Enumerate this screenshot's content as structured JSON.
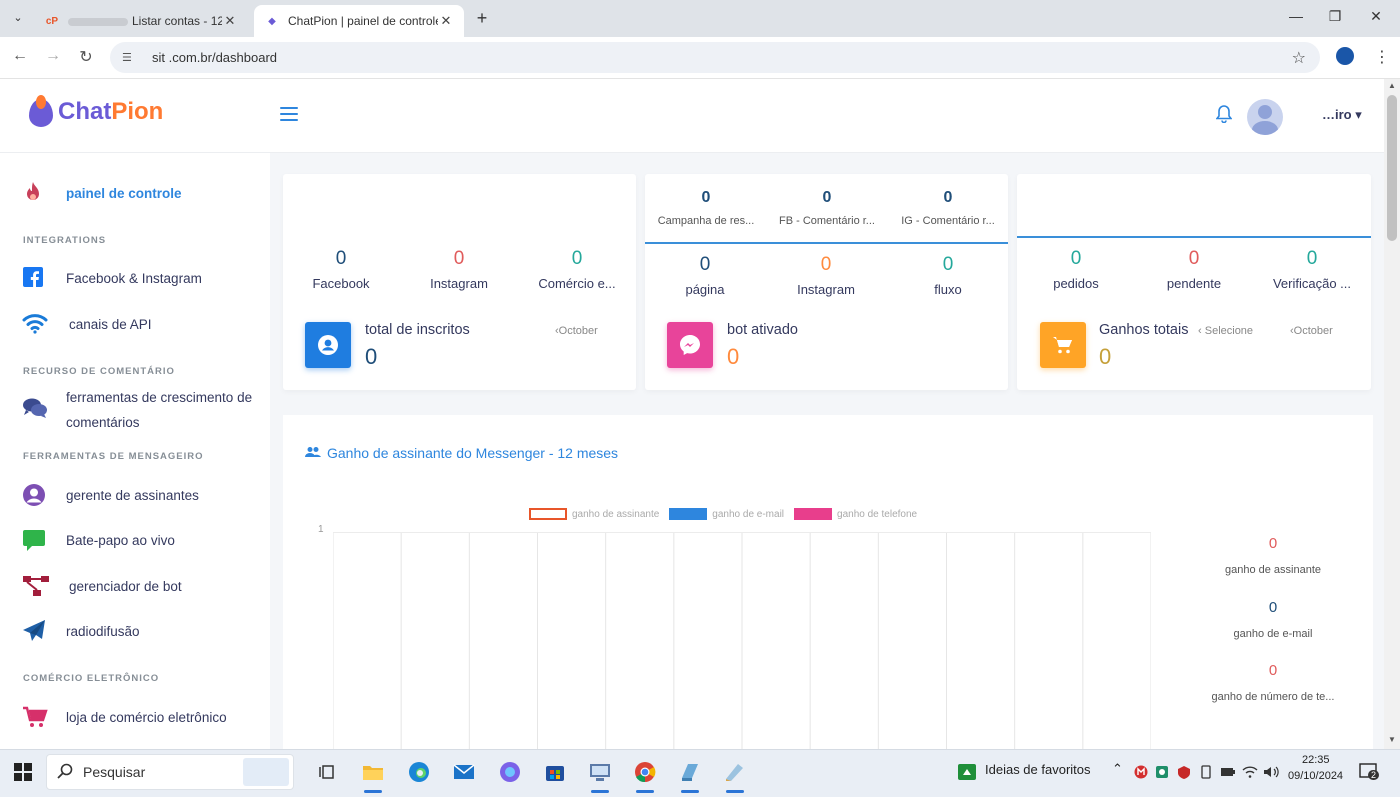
{
  "browser": {
    "tab_inactive": {
      "title": "Listar contas - 12"
    },
    "tab_active": {
      "title": "ChatPion | painel de controle"
    },
    "url": "sit .com.br/dashboard"
  },
  "header": {
    "logo_chat": "Chat",
    "logo_pion": "Pion",
    "username": "…iro"
  },
  "sidebar": {
    "dashboard": "painel de controle",
    "integrations_head": "INTEGRATIONS",
    "facebook_instagram": "Facebook & Instagram",
    "api_channels": "canais de API",
    "comment_head": "RECURSO DE COMENTÁRIO",
    "comment_tools_1": "ferramentas de crescimento de",
    "comment_tools_2": "comentários",
    "messenger_head": "FERRAMENTAS DE MENSAGEIRO",
    "subscriber_manager": "gerente de assinantes",
    "live_chat": "Bate-papo ao vivo",
    "bot_manager": "gerenciador de bot",
    "broadcast": "radiodifusão",
    "ecommerce_head": "COMÉRCIO ELETRÔNICO",
    "ecommerce_store": "loja de comércio eletrônico"
  },
  "card1": {
    "stats": [
      {
        "value": "0",
        "label": "Facebook"
      },
      {
        "value": "0",
        "label": "Instagram"
      },
      {
        "value": "0",
        "label": "Comércio e..."
      }
    ],
    "title": "total de inscritos",
    "total": "0",
    "month": "October"
  },
  "card2": {
    "top_stats": [
      {
        "value": "0",
        "label": "Campanha de res..."
      },
      {
        "value": "0",
        "label": "FB - Comentário r..."
      },
      {
        "value": "0",
        "label": "IG - Comentário r..."
      }
    ],
    "stats": [
      {
        "value": "0",
        "label": "página"
      },
      {
        "value": "0",
        "label": "Instagram"
      },
      {
        "value": "0",
        "label": "fluxo"
      }
    ],
    "title": "bot ativado",
    "total": "0"
  },
  "card3": {
    "stats": [
      {
        "value": "0",
        "label": "pedidos"
      },
      {
        "value": "0",
        "label": "pendente"
      },
      {
        "value": "0",
        "label": "Verificação ..."
      }
    ],
    "title": "Ganhos totais",
    "total": "0",
    "select": "Selecione",
    "month": "October"
  },
  "chart": {
    "title": "Ganho de assinante do Messenger - 12 meses",
    "side_stats": [
      {
        "value": "0",
        "label": "ganho de assinante"
      },
      {
        "value": "0",
        "label": "ganho de e-mail"
      },
      {
        "value": "0",
        "label": "ganho de número de te..."
      }
    ]
  },
  "chart_data": {
    "type": "bar",
    "title": "",
    "xlabel": "",
    "ylabel": "",
    "ylim": [
      0,
      1
    ],
    "y_ticks": [
      "1"
    ],
    "categories": [
      "",
      "",
      "",
      "",
      "",
      "",
      "",
      "",
      "",
      "",
      "",
      ""
    ],
    "legend_position": "top",
    "series": [
      {
        "name": "ganho de assinante",
        "color": "#e8562a",
        "style": "outline",
        "values": [
          0,
          0,
          0,
          0,
          0,
          0,
          0,
          0,
          0,
          0,
          0,
          0
        ]
      },
      {
        "name": "ganho de e-mail",
        "color": "#2e86de",
        "values": [
          0,
          0,
          0,
          0,
          0,
          0,
          0,
          0,
          0,
          0,
          0,
          0
        ]
      },
      {
        "name": "ganho de telefone",
        "color": "#e83e8c",
        "values": [
          0,
          0,
          0,
          0,
          0,
          0,
          0,
          0,
          0,
          0,
          0,
          0
        ]
      }
    ]
  },
  "taskbar": {
    "search_placeholder": "Pesquisar",
    "favorites": "Ideias de favoritos",
    "time": "22:35",
    "date": "09/10/2024",
    "notifications": "2"
  },
  "colors": {
    "accent": "#2e86de",
    "brand_purple": "#6b5bd6",
    "brand_orange": "#ff7a32",
    "subscribers_icon": "#1f7de0",
    "bot_icon": "#e8449a",
    "earnings_icon": "#ffa426"
  }
}
